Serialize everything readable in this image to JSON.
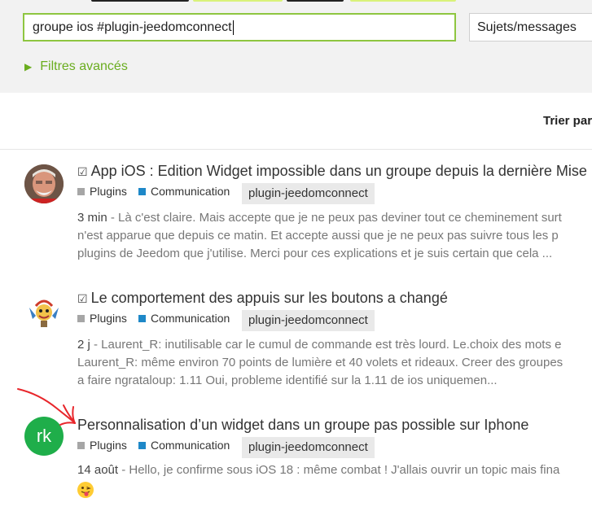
{
  "search": {
    "query": "groupe ios #plugin-jeedomconnect",
    "scope": "Sujets/messages",
    "advanced_filters": "Filtres avancés"
  },
  "sort": {
    "label": "Trier par"
  },
  "results": [
    {
      "title": "App iOS : Edition Widget impossible dans un groupe depuis la dernière Mise",
      "solved": true,
      "categories": [
        {
          "name": "Plugins",
          "color": "#a6a6a6"
        },
        {
          "name": "Communication",
          "color": "#1e88c8"
        }
      ],
      "tag": "plugin-jeedomconnect",
      "date": "3 min",
      "excerpt_lines": [
        " - Là c'est claire. Mais accepte que je ne peux pas deviner tout ce cheminement surt",
        "n'est apparue que depuis ce matin. Et accepte aussi que je ne peux pas suivre tous les p",
        "plugins de Jeedom que j'utilise. Merci pour ces explications et je suis certain que cela ..."
      ],
      "avatar": "photo"
    },
    {
      "title": "Le comportement des appuis sur les boutons a changé",
      "solved": true,
      "categories": [
        {
          "name": "Plugins",
          "color": "#a6a6a6"
        },
        {
          "name": "Communication",
          "color": "#1e88c8"
        }
      ],
      "tag": "plugin-jeedomconnect",
      "date": "2 j",
      "excerpt_lines": [
        " - Laurent_R: inutilisable car le cumul de commande est très lourd. Le.choix des mots e",
        "Laurent_R: même environ 70 points de lumière et 40 volets et rideaux. Creer des groupes",
        "a faire ngrataloup: 1.11 Oui, probleme identifié sur la 1.11 de ios uniquemen..."
      ],
      "avatar": "cartoon"
    },
    {
      "title": "Personnalisation d’un widget dans un groupe pas possible sur Iphone",
      "solved": false,
      "categories": [
        {
          "name": "Plugins",
          "color": "#a6a6a6"
        },
        {
          "name": "Communication",
          "color": "#1e88c8"
        }
      ],
      "tag": "plugin-jeedomconnect",
      "date": "14 août",
      "excerpt_lines": [
        " - Hello, je confirme sous iOS 18 : même combat ! J'allais ouvrir un topic mais fina"
      ],
      "avatar_initials": "rk",
      "avatar_color": "#1fae4a"
    }
  ],
  "colors": {
    "accent_green": "#8ec640",
    "link_green": "#6aad1f",
    "annotation_red": "#e8262b"
  }
}
